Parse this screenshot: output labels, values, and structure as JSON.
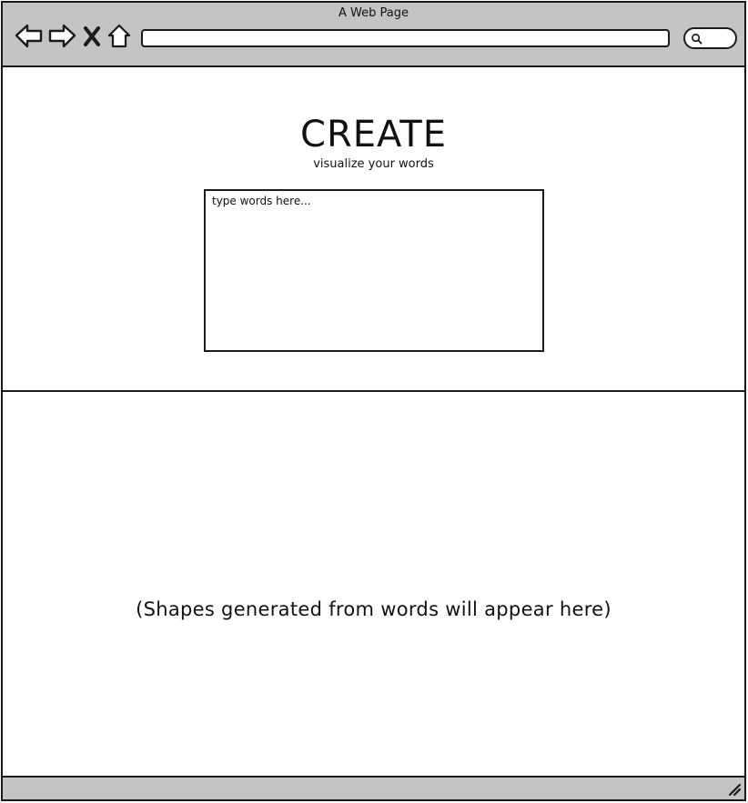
{
  "browser": {
    "title": "A Web Page",
    "icons": {
      "back": "back-arrow-icon",
      "forward": "forward-arrow-icon",
      "stop": "close-icon",
      "home": "home-icon",
      "search": "search-icon",
      "resize": "resize-grip-icon"
    },
    "address_value": ""
  },
  "page": {
    "heading": "CREATE",
    "subheading": "visualize your words",
    "input_placeholder": "type words here...",
    "output_placeholder": "(Shapes generated from words will appear here)"
  },
  "colors": {
    "chrome": "#c4c4c4",
    "border": "#1a1a1a",
    "background": "#ffffff"
  }
}
